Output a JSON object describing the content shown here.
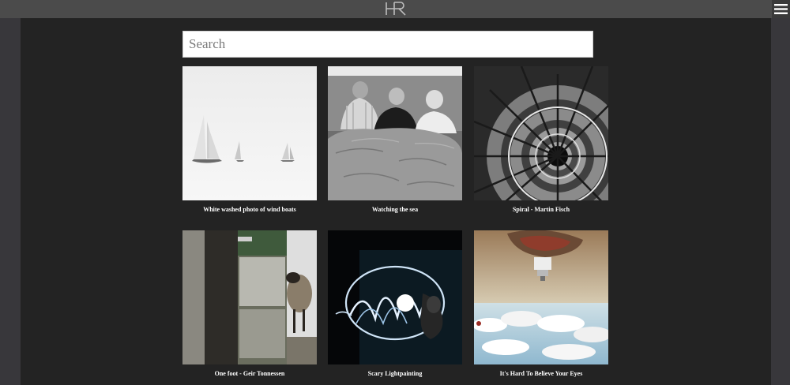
{
  "header": {
    "logo_text": "HR",
    "menu_icon": "hamburger-menu-icon"
  },
  "search": {
    "placeholder": "Search",
    "value": ""
  },
  "gallery": [
    {
      "caption": "White washed photo of wind boats",
      "icon": "sailboats-photo"
    },
    {
      "caption": "Watching the sea",
      "icon": "seniors-at-sea-photo"
    },
    {
      "caption": "Spiral - Martin Fisch",
      "icon": "spiral-staircase-photo"
    },
    {
      "caption": "One foot - Geir Tonnessen",
      "icon": "sheep-doorway-photo"
    },
    {
      "caption": "Scary Lightpainting",
      "icon": "lightpainting-photo"
    },
    {
      "caption": "It's Hard To Believe Your Eyes",
      "icon": "upside-down-sky-photo"
    }
  ]
}
